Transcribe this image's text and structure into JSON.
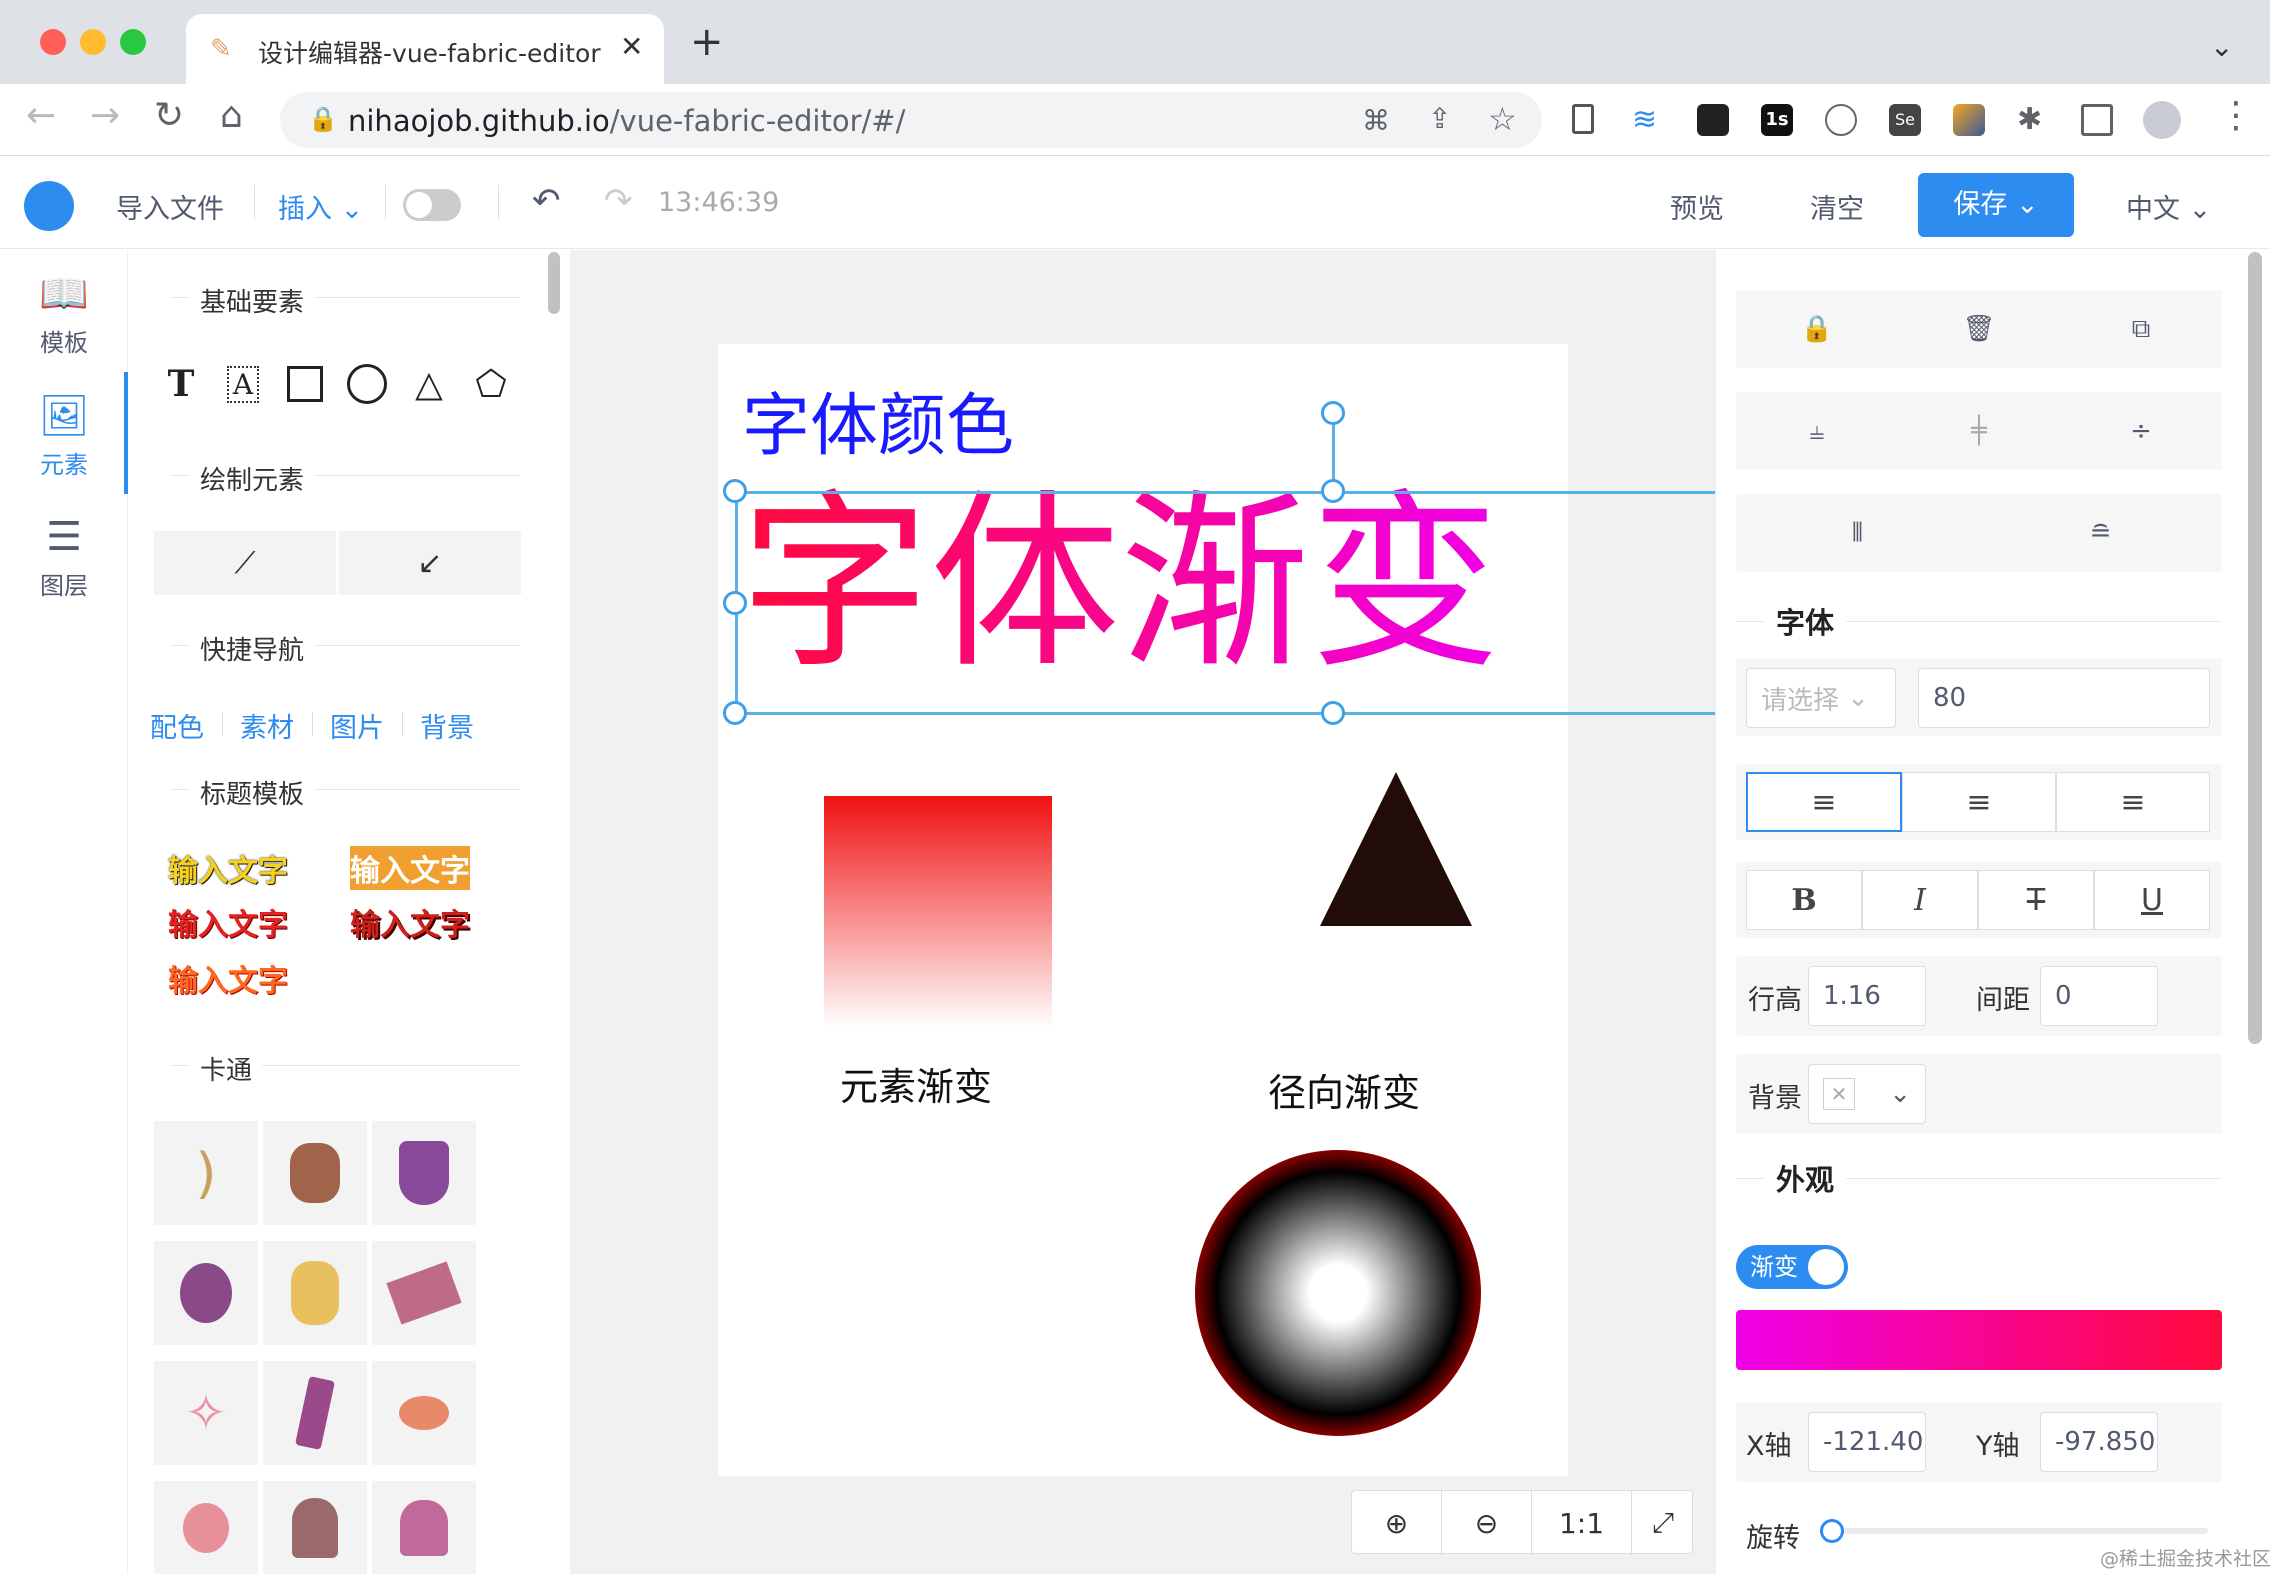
{
  "browser": {
    "tab_title": "设计编辑器-vue-fabric-editor",
    "url_host": "nihaojob.github.io",
    "url_path": "/vue-fabric-editor/#/"
  },
  "toolbar": {
    "import_label": "导入文件",
    "insert_label": "插入",
    "timestamp": "13:46:39",
    "preview_label": "预览",
    "clear_label": "清空",
    "save_label": "保存",
    "lang_label": "中文"
  },
  "leftnav": {
    "items": [
      {
        "label": "模板",
        "icon": "book-icon"
      },
      {
        "label": "元素",
        "icon": "image-icon"
      },
      {
        "label": "图层",
        "icon": "layers-icon"
      }
    ]
  },
  "panel": {
    "basic_title": "基础要素",
    "draw_title": "绘制元素",
    "quick_title": "快捷导航",
    "quick_links": [
      "配色",
      "素材",
      "图片",
      "背景"
    ],
    "title_tpl_title": "标题模板",
    "title_tpl_text": "输入文字",
    "cartoon_title": "卡通"
  },
  "canvas": {
    "text_color": "字体颜色",
    "text_gradient": "字体渐变",
    "label_element_gradient": "元素渐变",
    "label_radial_gradient": "径向渐变"
  },
  "zoom": {
    "ratio_label": "1:1"
  },
  "rightpanel": {
    "font_section": "字体",
    "font_select_placeholder": "请选择",
    "font_size": "80",
    "line_height_label": "行高",
    "line_height": "1.16",
    "spacing_label": "间距",
    "spacing": "0",
    "background_label": "背景",
    "appearance_section": "外观",
    "gradient_toggle": "渐变",
    "x_label": "X轴",
    "x_value": "-121.40",
    "y_label": "Y轴",
    "y_value": "-97.850",
    "rotate_label": "旋转"
  },
  "colors": {
    "accent": "#2d8cf0",
    "gradient_start": "#f000e8",
    "gradient_end": "#ff0a3c",
    "text_color_blue": "#1a1aff"
  },
  "watermark": "@稀土掘金技术社区"
}
